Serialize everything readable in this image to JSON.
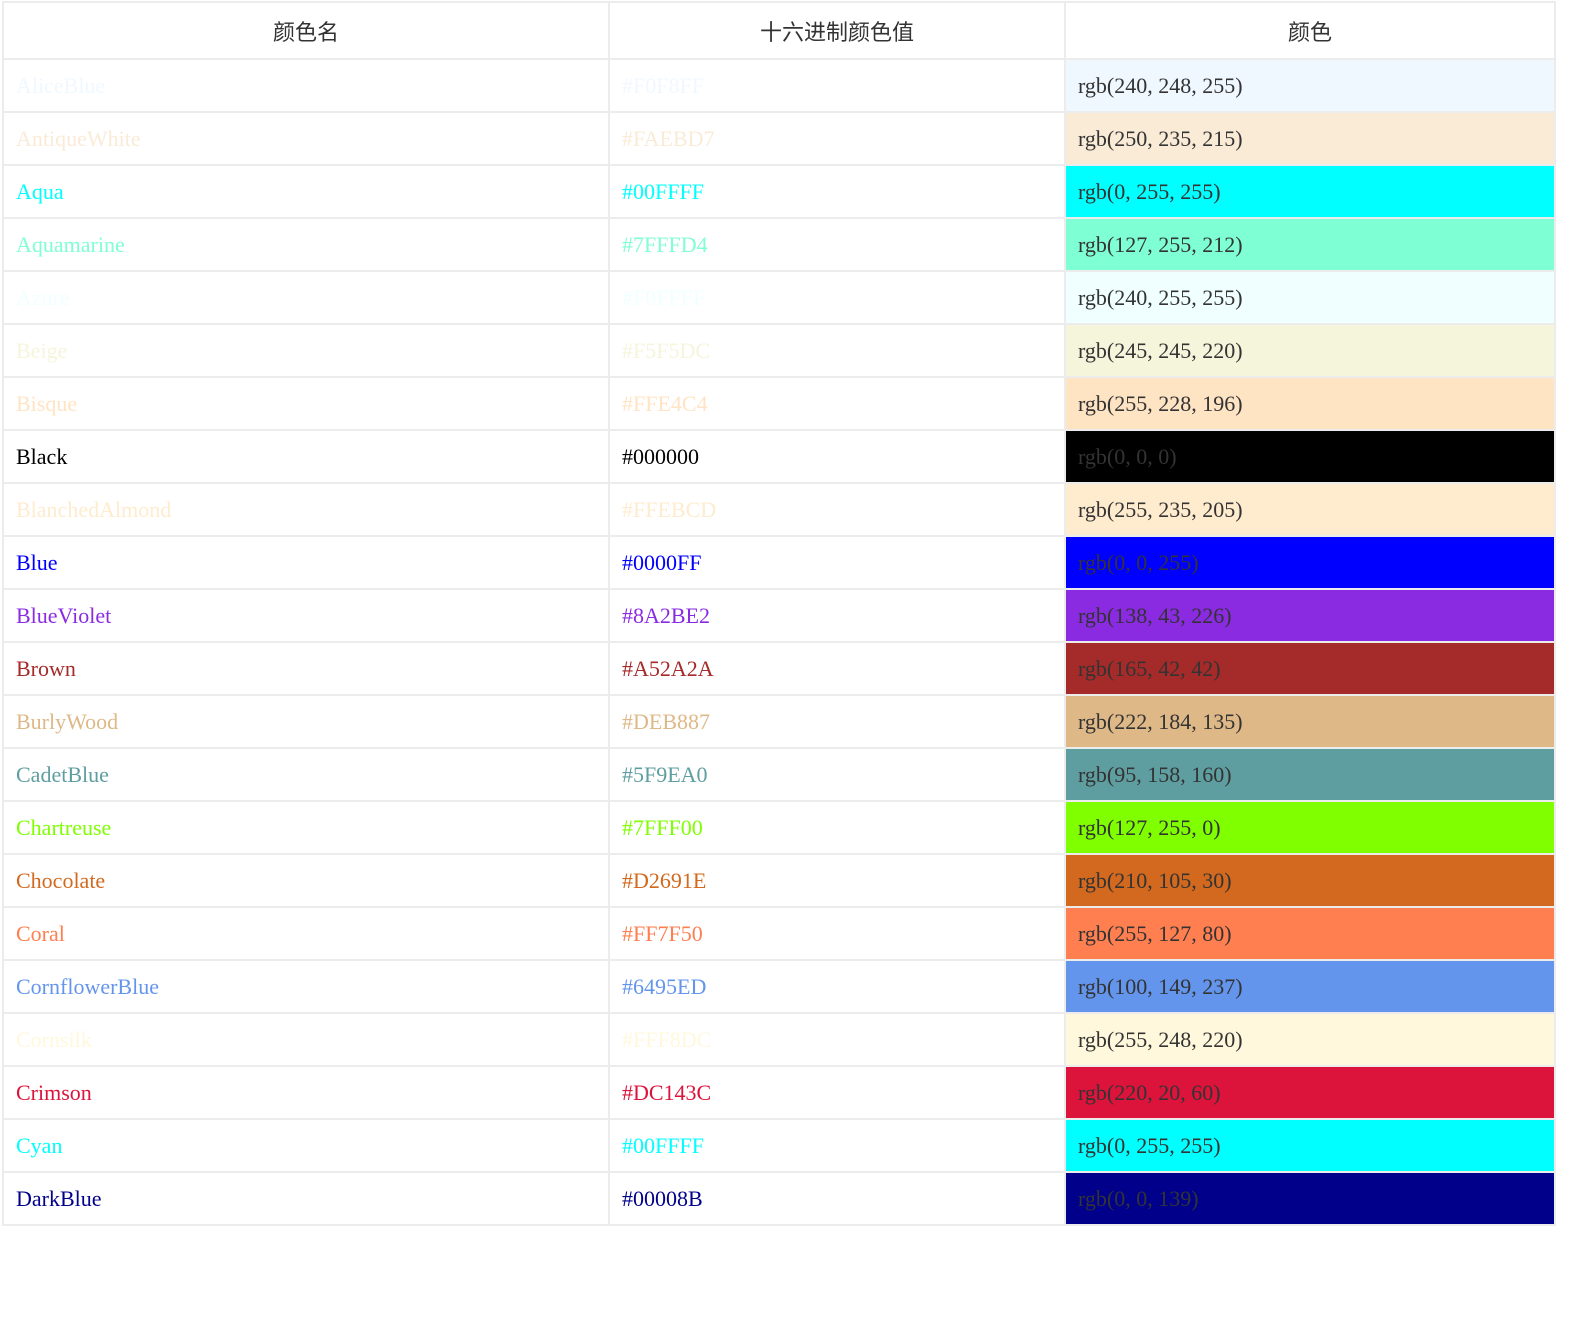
{
  "table": {
    "headers": [
      "颜色名",
      "十六进制颜色值",
      "颜色"
    ],
    "rows": [
      {
        "name": "AliceBlue",
        "hex": "#F0F8FF",
        "rgb": "rgb(240, 248, 255)"
      },
      {
        "name": "AntiqueWhite",
        "hex": "#FAEBD7",
        "rgb": "rgb(250, 235, 215)"
      },
      {
        "name": "Aqua",
        "hex": "#00FFFF",
        "rgb": "rgb(0, 255, 255)"
      },
      {
        "name": "Aquamarine",
        "hex": "#7FFFD4",
        "rgb": "rgb(127, 255, 212)"
      },
      {
        "name": "Azure",
        "hex": "#F0FFFF",
        "rgb": "rgb(240, 255, 255)"
      },
      {
        "name": "Beige",
        "hex": "#F5F5DC",
        "rgb": "rgb(245, 245, 220)"
      },
      {
        "name": "Bisque",
        "hex": "#FFE4C4",
        "rgb": "rgb(255, 228, 196)"
      },
      {
        "name": "Black",
        "hex": "#000000",
        "rgb": "rgb(0, 0, 0)"
      },
      {
        "name": "BlanchedAlmond",
        "hex": "#FFEBCD",
        "rgb": "rgb(255, 235, 205)"
      },
      {
        "name": "Blue",
        "hex": "#0000FF",
        "rgb": "rgb(0, 0, 255)"
      },
      {
        "name": "BlueViolet",
        "hex": "#8A2BE2",
        "rgb": "rgb(138, 43, 226)"
      },
      {
        "name": "Brown",
        "hex": "#A52A2A",
        "rgb": "rgb(165, 42, 42)"
      },
      {
        "name": "BurlyWood",
        "hex": "#DEB887",
        "rgb": "rgb(222, 184, 135)"
      },
      {
        "name": "CadetBlue",
        "hex": "#5F9EA0",
        "rgb": "rgb(95, 158, 160)"
      },
      {
        "name": "Chartreuse",
        "hex": "#7FFF00",
        "rgb": "rgb(127, 255, 0)"
      },
      {
        "name": "Chocolate",
        "hex": "#D2691E",
        "rgb": "rgb(210, 105, 30)"
      },
      {
        "name": "Coral",
        "hex": "#FF7F50",
        "rgb": "rgb(255, 127, 80)"
      },
      {
        "name": "CornflowerBlue",
        "hex": "#6495ED",
        "rgb": "rgb(100, 149, 237)"
      },
      {
        "name": "Cornsilk",
        "hex": "#FFF8DC",
        "rgb": "rgb(255, 248, 220)"
      },
      {
        "name": "Crimson",
        "hex": "#DC143C",
        "rgb": "rgb(220, 20, 60)"
      },
      {
        "name": "Cyan",
        "hex": "#00FFFF",
        "rgb": "rgb(0, 255, 255)"
      },
      {
        "name": "DarkBlue",
        "hex": "#00008B",
        "rgb": "rgb(0, 0, 139)"
      }
    ]
  }
}
